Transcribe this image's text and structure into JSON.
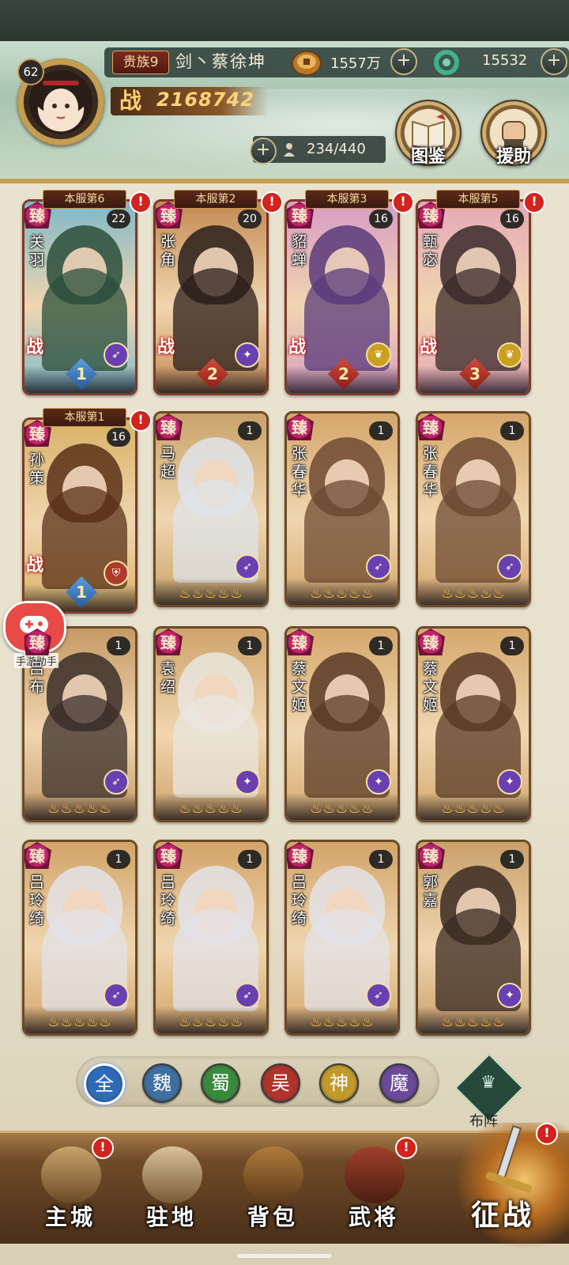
{
  "player": {
    "level": "62",
    "noble_rank": "贵族9",
    "name": "剑丶蔡徐坤",
    "copper": "1557万",
    "jade": "15532",
    "power_icon": "战",
    "power": "2168742",
    "hero_capacity": "234/440"
  },
  "side_buttons": [
    {
      "label": "图鉴",
      "icon": "book-icon"
    },
    {
      "label": "援助",
      "icon": "fist-icon"
    }
  ],
  "heroes": [
    {
      "name": "关羽",
      "rank": "本服第6",
      "count": "22",
      "alert": true,
      "battle": "战",
      "class_icon": "archer",
      "star": "1",
      "color": "#7fb8c8",
      "hair": "#2a4e3a"
    },
    {
      "name": "张角",
      "rank": "本服第2",
      "count": "20",
      "alert": true,
      "battle": "战",
      "class_icon": "mage",
      "star": "2",
      "color": "#c48a52",
      "hair": "#2a1e1a"
    },
    {
      "name": "貂蝉",
      "rank": "本服第3",
      "count": "16",
      "alert": true,
      "battle": "战",
      "class_icon": "support",
      "star": "2",
      "color": "#d79bc4",
      "hair": "#5a3a7a"
    },
    {
      "name": "甄宓",
      "rank": "本服第5",
      "count": "16",
      "alert": true,
      "battle": "战",
      "class_icon": "support",
      "star": "3",
      "color": "#e5a8b8",
      "hair": "#3a2a2a"
    },
    {
      "name": "孙策",
      "rank": "本服第1",
      "count": "16",
      "alert": true,
      "battle": "战",
      "class_icon": "defense",
      "star": "1",
      "color": "#d8b266",
      "hair": "#5a3018"
    },
    {
      "name": "马超",
      "rank": "",
      "count": "1",
      "alert": false,
      "battle": "",
      "class_icon": "archer",
      "flames": "ððððð",
      "color": "#c9a36a",
      "hair": "#dfe4ea"
    },
    {
      "name": "张春华",
      "rank": "",
      "count": "1",
      "alert": false,
      "battle": "",
      "class_icon": "archer",
      "flames": "ððððð",
      "color": "#d5a66a",
      "hair": "#6e4a32"
    },
    {
      "name": "张春华",
      "rank": "",
      "count": "1",
      "alert": false,
      "battle": "",
      "class_icon": "archer",
      "flames": "ððððð",
      "color": "#d5a66a",
      "hair": "#6e4a32"
    },
    {
      "name": "吕布",
      "rank": "",
      "count": "1",
      "alert": false,
      "battle": "",
      "class_icon": "archer",
      "flames": "ððððð",
      "color": "#c69a66",
      "hair": "#3a2e2a"
    },
    {
      "name": "袁绍",
      "rank": "",
      "count": "1",
      "alert": false,
      "battle": "",
      "class_icon": "mage",
      "flames": "ððððð",
      "color": "#cfa46a",
      "hair": "#e9e6df"
    },
    {
      "name": "蔡文姬",
      "rank": "",
      "count": "1",
      "alert": false,
      "battle": "",
      "class_icon": "mage",
      "flames": "ððððð",
      "color": "#d4a86c",
      "hair": "#5a3a26"
    },
    {
      "name": "蔡文姬",
      "rank": "",
      "count": "1",
      "alert": false,
      "battle": "",
      "class_icon": "mage",
      "flames": "ððððð",
      "color": "#d4a86c",
      "hair": "#5a3a26"
    },
    {
      "name": "吕玲绮",
      "rank": "",
      "count": "1",
      "alert": false,
      "battle": "",
      "class_icon": "archer",
      "flames": "ððððð",
      "color": "#d2a468",
      "hair": "#e3e3e8"
    },
    {
      "name": "吕玲绮",
      "rank": "",
      "count": "1",
      "alert": false,
      "battle": "",
      "class_icon": "archer",
      "flames": "ððððð",
      "color": "#d2a468",
      "hair": "#e3e3e8"
    },
    {
      "name": "吕玲绮",
      "rank": "",
      "count": "1",
      "alert": false,
      "battle": "",
      "class_icon": "archer",
      "flames": "ððððð",
      "color": "#d2a468",
      "hair": "#e3e3e8"
    },
    {
      "name": "郭嘉",
      "rank": "",
      "count": "1",
      "alert": false,
      "battle": "",
      "class_icon": "mage",
      "flames": "ððððð",
      "color": "#c9a06a",
      "hair": "#3a2a22"
    }
  ],
  "zhen_mark": "臻",
  "factions": [
    {
      "label": "全",
      "color": "#2f6ab8",
      "selected": true
    },
    {
      "label": "魏",
      "color": "#3f6fa0"
    },
    {
      "label": "蜀",
      "color": "#3a8a3e"
    },
    {
      "label": "吴",
      "color": "#b2332c"
    },
    {
      "label": "神",
      "color": "#c19a2a"
    },
    {
      "label": "魔",
      "color": "#6b4a9a"
    }
  ],
  "formation_label": "布阵",
  "nav": [
    {
      "label": "主城",
      "alert": true
    },
    {
      "label": "驻地",
      "alert": false
    },
    {
      "label": "背包",
      "alert": false
    },
    {
      "label": "武将",
      "alert": true
    }
  ],
  "battle_label": "征战",
  "assistant_label": "手游助手",
  "colors": {
    "frame_gold": "#c59e52",
    "alert_red": "#d2231d",
    "rank_bg": "#5c2a18"
  }
}
